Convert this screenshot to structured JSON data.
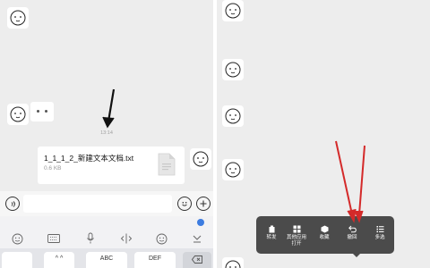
{
  "chat": {
    "timestamp": "13:14",
    "dots_message": "• •",
    "file": {
      "name": "1_1_1_2_新建文本文档.txt",
      "size": "0.6 KB"
    }
  },
  "keyboard": {
    "keys": [
      "",
      "^ ^",
      "ABC",
      "DEF",
      ""
    ]
  },
  "context_menu": {
    "items": [
      {
        "label": "转发",
        "icon": "forward-icon"
      },
      {
        "label": "其他应用",
        "label2": "打开",
        "icon": "open-with-icon"
      },
      {
        "label": "收藏",
        "icon": "favorite-icon"
      },
      {
        "label": "撤回",
        "icon": "recall-icon"
      },
      {
        "label": "多选",
        "icon": "multiselect-icon"
      }
    ]
  },
  "annotations": {
    "arrow_color": "#111111",
    "red_arrow_color": "#d42a2a"
  }
}
